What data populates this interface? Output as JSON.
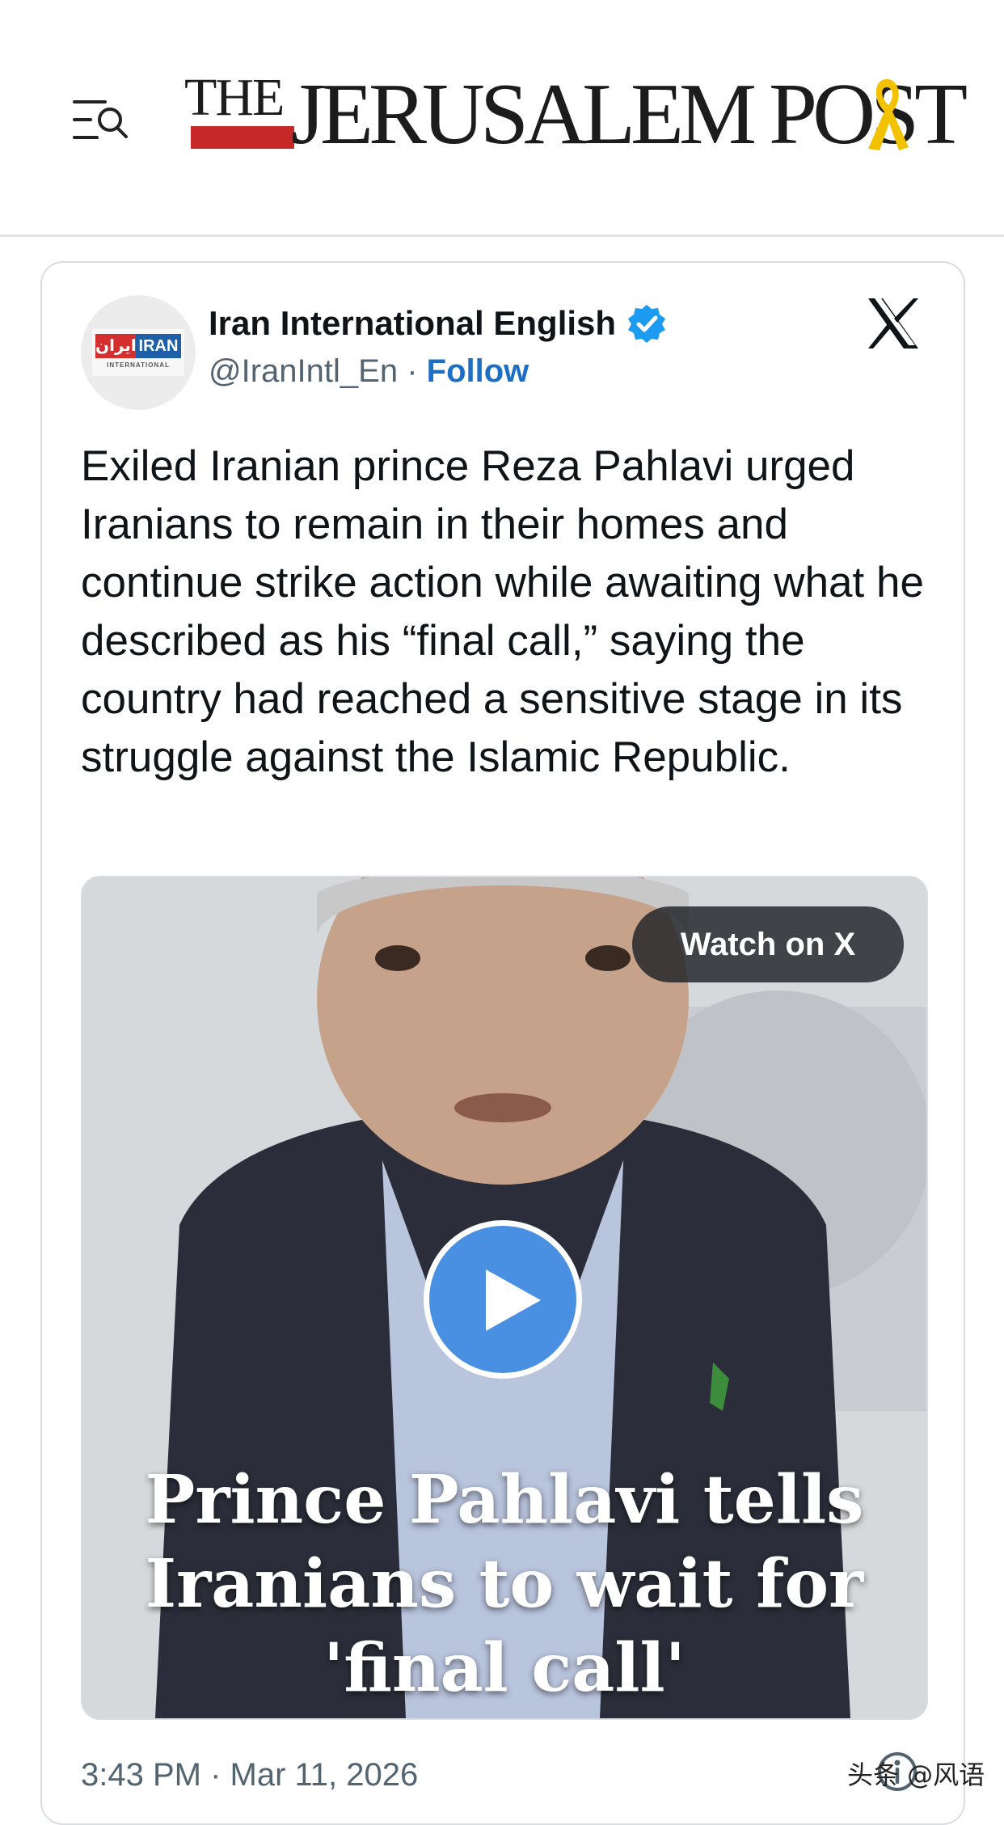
{
  "header": {
    "logo_the": "THE",
    "logo_main": "JERUSALEM POST",
    "colors": {
      "logo_bar": "#c62828",
      "ribbon": "#f2c200"
    },
    "icons": [
      "menu-search-icon",
      "yellow-ribbon-icon"
    ]
  },
  "tweet": {
    "display_name": "Iran International English",
    "handle": "@IranIntl_En",
    "separator": "·",
    "follow_label": "Follow",
    "avatar": {
      "farsi_text": "ایران",
      "english_text": "IRAN",
      "sub_text": "INTERNATIONAL"
    },
    "text": "Exiled Iranian prince Reza Pahlavi urged Iranians to remain in their homes and continue strike action while awaiting what he described as his “final call,” saying the country had reached a sensitive stage in its struggle against the Islamic Republic.",
    "video": {
      "watch_label": "Watch on X",
      "caption_lines": [
        "Prince Pahlavi tells",
        "Iranians to wait for",
        "'final call'"
      ]
    },
    "timestamp": "3:43 PM · Mar 11, 2026",
    "colors": {
      "follow": "#1d6fc6",
      "verified": "#1d9bf0",
      "play": "#4a90e2"
    },
    "icons": [
      "verified-badge-icon",
      "x-logo-icon",
      "play-icon",
      "info-icon"
    ]
  },
  "watermark": "头条 @风语"
}
